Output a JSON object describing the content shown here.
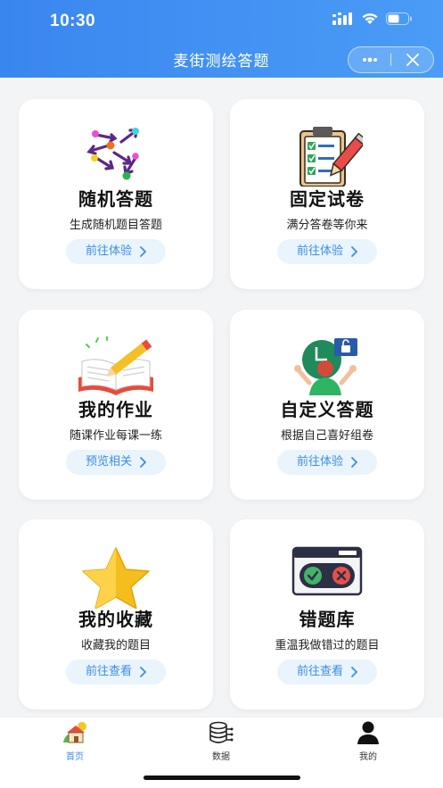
{
  "status_bar": {
    "time": "10:30"
  },
  "header": {
    "title": "麦街测绘答题"
  },
  "capsule": {
    "more_icon": "more-dots-icon",
    "close_icon": "close-icon"
  },
  "cards": [
    {
      "title": "随机答题",
      "subtitle": "生成随机题目答题",
      "button": "前往体验",
      "icon": "random-arrows-icon"
    },
    {
      "title": "固定试卷",
      "subtitle": "满分答卷等你来",
      "button": "前往体验",
      "icon": "clipboard-checklist-icon"
    },
    {
      "title": "我的作业",
      "subtitle": "随课作业每课一练",
      "button": "预览相关",
      "icon": "book-pencil-icon"
    },
    {
      "title": "自定义答题",
      "subtitle": "根据自己喜好组卷",
      "button": "前往体验",
      "icon": "custom-person-icon"
    },
    {
      "title": "我的收藏",
      "subtitle": "收藏我的题目",
      "button": "前往查看",
      "icon": "star-icon"
    },
    {
      "title": "错题库",
      "subtitle": "重温我做错过的题目",
      "button": "前往查看",
      "icon": "wrong-answers-window-icon"
    }
  ],
  "tabs": [
    {
      "label": "首页",
      "icon": "home-icon",
      "active": true
    },
    {
      "label": "数据",
      "icon": "database-icon",
      "active": false
    },
    {
      "label": "我的",
      "icon": "user-icon",
      "active": false
    }
  ],
  "colors": {
    "header": "#3a86f0",
    "accent": "#3a8ee6",
    "button_bg": "#eaf4fd"
  }
}
